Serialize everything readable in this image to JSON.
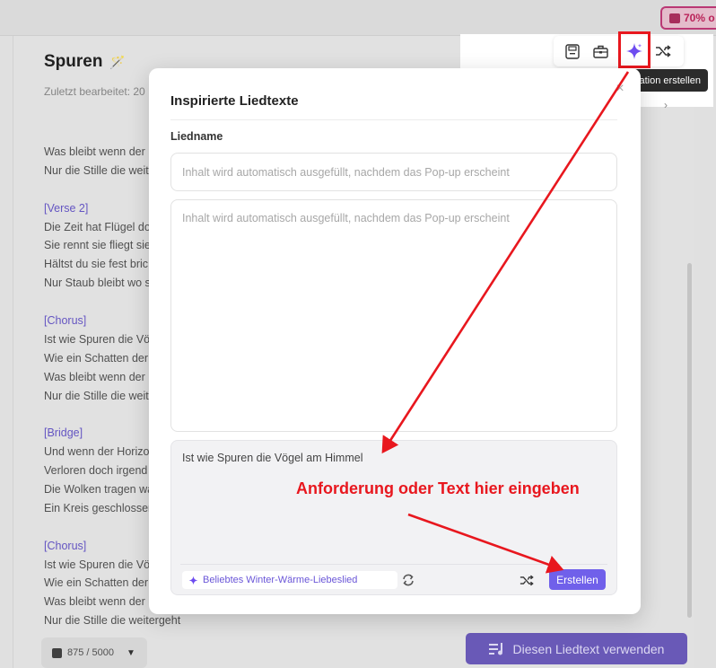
{
  "promo": {
    "label": "70% o"
  },
  "editor": {
    "title": "Spuren",
    "last_edited": "Zuletzt bearbeitet: 20",
    "lines": [
      {
        "text": "Was bleibt wenn der",
        "kind": "text"
      },
      {
        "text": "Nur die Stille die weite",
        "kind": "text"
      },
      {
        "text": "",
        "kind": "gap"
      },
      {
        "text": "[Verse 2]",
        "kind": "section"
      },
      {
        "text": "Die Zeit hat Flügel do",
        "kind": "text"
      },
      {
        "text": "Sie rennt sie fliegt sie",
        "kind": "text"
      },
      {
        "text": "Hältst du sie fest bric",
        "kind": "text"
      },
      {
        "text": "Nur Staub bleibt wo s",
        "kind": "text"
      },
      {
        "text": "",
        "kind": "gap"
      },
      {
        "text": "[Chorus]",
        "kind": "section"
      },
      {
        "text": "Ist wie Spuren die Vöc",
        "kind": "text"
      },
      {
        "text": "Wie ein Schatten der",
        "kind": "text"
      },
      {
        "text": "Was bleibt wenn der",
        "kind": "text"
      },
      {
        "text": "Nur die Stille die weite",
        "kind": "text"
      },
      {
        "text": "",
        "kind": "gap"
      },
      {
        "text": "[Bridge]",
        "kind": "section"
      },
      {
        "text": "Und wenn der Horizo",
        "kind": "text"
      },
      {
        "text": "Verloren doch irgend",
        "kind": "text"
      },
      {
        "text": "Die Wolken tragen wa",
        "kind": "text"
      },
      {
        "text": "Ein Kreis geschlossen",
        "kind": "text"
      },
      {
        "text": "",
        "kind": "gap"
      },
      {
        "text": "[Chorus]",
        "kind": "section"
      },
      {
        "text": "Ist wie Spuren die Vög",
        "kind": "text"
      },
      {
        "text": "Wie ein Schatten der",
        "kind": "text"
      },
      {
        "text": "Was bleibt wenn der",
        "kind": "text"
      },
      {
        "text": "Nur die Stille die weitergeht",
        "kind": "text"
      }
    ],
    "counter": "875 / 5000",
    "use_button": "Diesen Liedtext verwenden"
  },
  "toolbar": {
    "tooltip": "ration erstellen",
    "icons": [
      "save-icon",
      "toolbox-icon",
      "sparkle-icon",
      "shuffle-icon"
    ]
  },
  "modal": {
    "title": "Inspirierte Liedtexte",
    "name_label": "Liedname",
    "name_placeholder": "Inhalt wird automatisch ausgefüllt, nachdem das Pop-up erscheint",
    "lyrics_placeholder": "Inhalt wird automatisch ausgefüllt, nachdem das Pop-up erscheint",
    "prompt_text": "Ist wie Spuren die Vögel am Himmel",
    "suggestion": "Beliebtes Winter-Wärme-Liebeslied",
    "create_label": "Erstellen"
  },
  "annotation": {
    "text": "Anforderung oder Text hier eingeben",
    "color": "#e8171e"
  },
  "colors": {
    "accent": "#7060ea",
    "use_button": "#6f5ec1"
  }
}
